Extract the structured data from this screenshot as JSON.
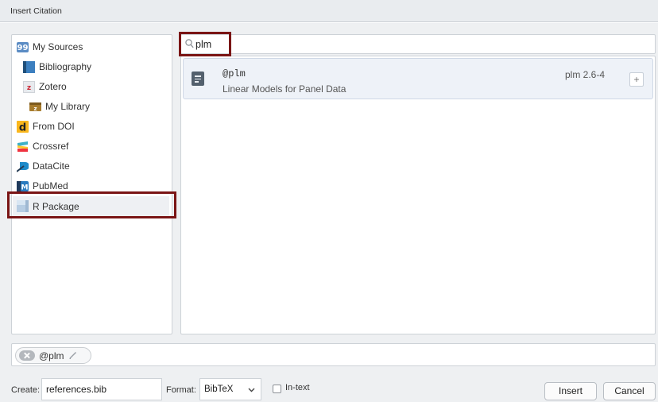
{
  "window": {
    "title": "Insert Citation"
  },
  "sources": {
    "items": [
      {
        "label": "My Sources",
        "icon": "my-sources-icon"
      },
      {
        "label": "Bibliography",
        "icon": "bibliography-icon"
      },
      {
        "label": "Zotero",
        "icon": "zotero-icon"
      },
      {
        "label": "My Library",
        "icon": "library-icon"
      },
      {
        "label": "From DOI",
        "icon": "doi-icon"
      },
      {
        "label": "Crossref",
        "icon": "crossref-icon"
      },
      {
        "label": "DataCite",
        "icon": "datacite-icon"
      },
      {
        "label": "PubMed",
        "icon": "pubmed-icon"
      },
      {
        "label": "R Package",
        "icon": "r-package-icon",
        "selected": true
      }
    ]
  },
  "search": {
    "value": "plm",
    "placeholder": ""
  },
  "results": [
    {
      "key": "@plm",
      "description": "Linear Models for Panel Data",
      "version": "plm 2.6-4",
      "add_label": "+"
    }
  ],
  "selected_citations": [
    {
      "label": "@plm"
    }
  ],
  "footer": {
    "create_label": "Create:",
    "create_value": "references.bib",
    "format_label": "Format:",
    "format_value": "BibTeX",
    "intext_label": "In-text",
    "intext_checked": false,
    "insert_label": "Insert",
    "cancel_label": "Cancel"
  },
  "colors": {
    "highlight": "#7a1515",
    "selected_item_bg": "#eef0f3",
    "result_bg": "#eef2f8"
  }
}
